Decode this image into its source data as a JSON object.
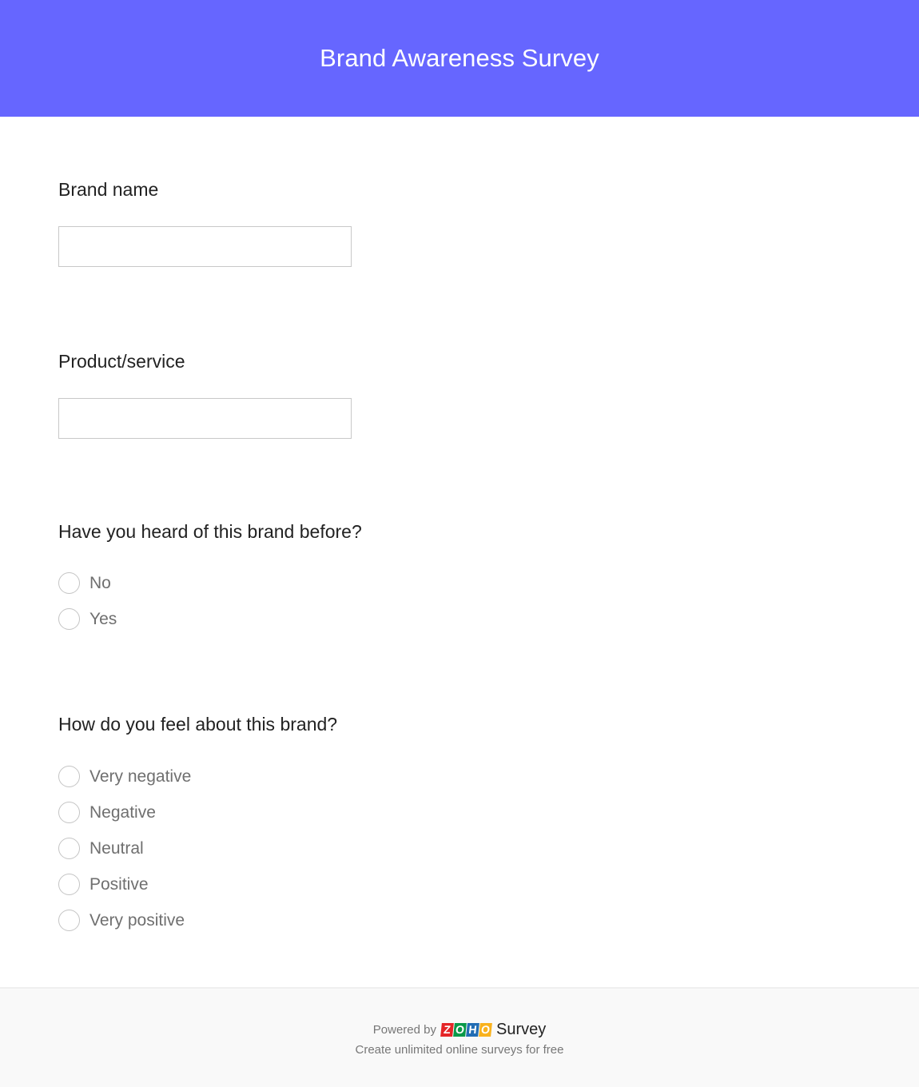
{
  "header": {
    "title": "Brand Awareness Survey",
    "background_color": "#6666ff"
  },
  "questions": [
    {
      "label": "Brand name",
      "type": "text",
      "value": "",
      "placeholder": ""
    },
    {
      "label": "Product/service",
      "type": "text",
      "value": "",
      "placeholder": ""
    },
    {
      "label": "Have you heard of this brand before?",
      "type": "radio",
      "options": [
        "No",
        "Yes"
      ]
    },
    {
      "label": "How do you feel about this brand?",
      "type": "radio",
      "options": [
        "Very negative",
        "Negative",
        "Neutral",
        "Positive",
        "Very positive"
      ]
    }
  ],
  "footer": {
    "powered_by": "Powered by",
    "logo_letters": [
      "Z",
      "O",
      "H",
      "O"
    ],
    "logo_colors": [
      "#e42527",
      "#089949",
      "#226db4",
      "#f9b21d"
    ],
    "product_name": "Survey",
    "tagline": "Create unlimited online surveys for free"
  }
}
